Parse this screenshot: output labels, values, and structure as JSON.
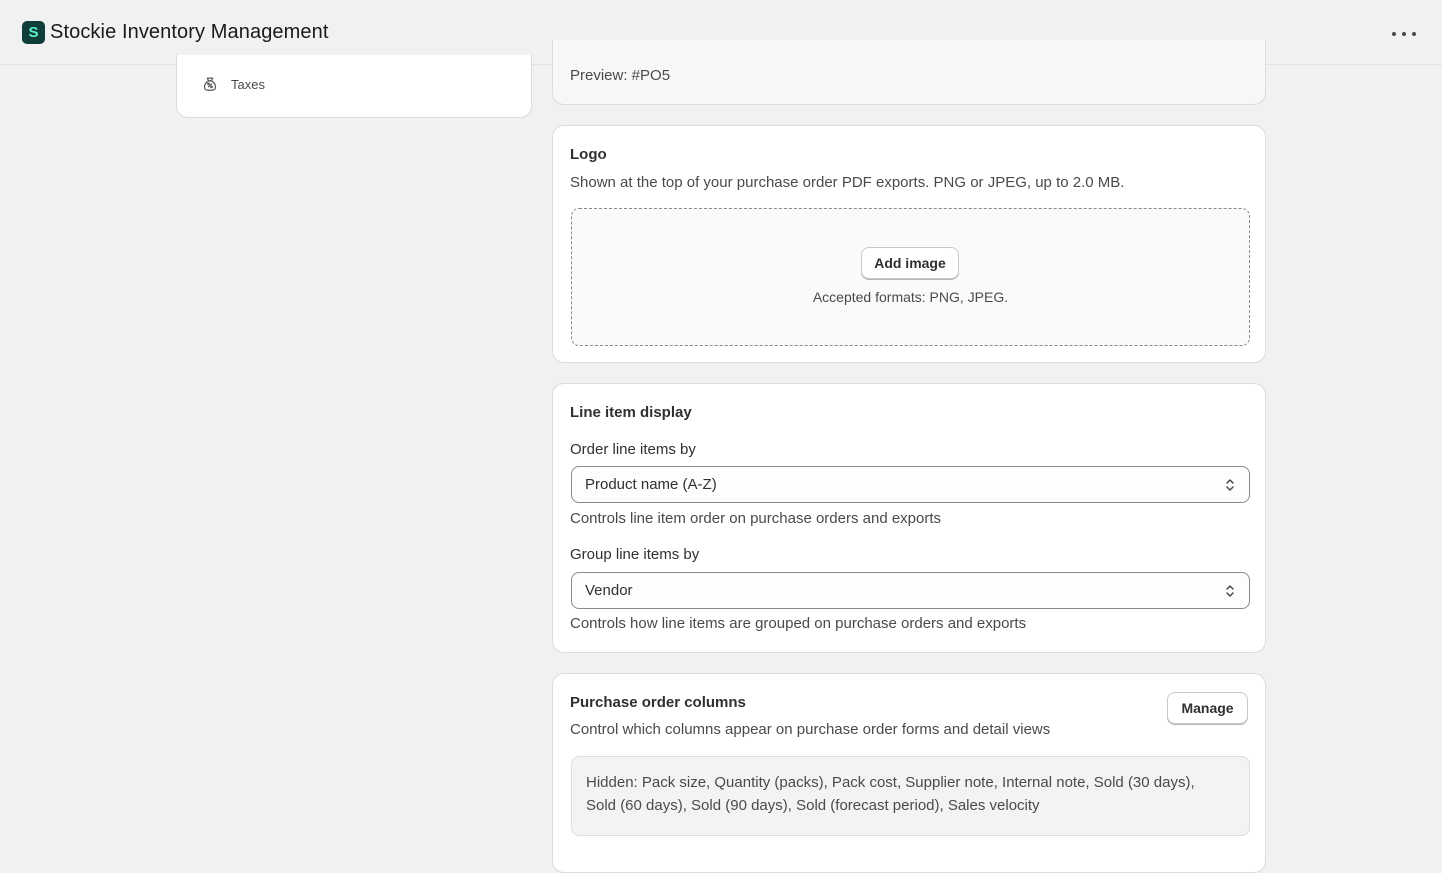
{
  "app": {
    "title": "Stockie Inventory Management",
    "logo_letter": "S"
  },
  "sidebar": {
    "items": [
      {
        "label": "Taxes",
        "icon": "tax-bag-icon"
      }
    ]
  },
  "numbering": {
    "preview": "Preview: #PO5"
  },
  "logo_card": {
    "heading": "Logo",
    "description": "Shown at the top of your purchase order PDF exports. PNG or JPEG, up to 2.0 MB.",
    "add_button": "Add image",
    "accepted": "Accepted formats: PNG, JPEG."
  },
  "line_items": {
    "heading": "Line item display",
    "order_label": "Order line items by",
    "order_value": "Product name (A-Z)",
    "order_help": "Controls line item order on purchase orders and exports",
    "group_label": "Group line items by",
    "group_value": "Vendor",
    "group_help": "Controls how line items are grouped on purchase orders and exports"
  },
  "columns": {
    "heading": "Purchase order columns",
    "description": "Control which columns appear on purchase order forms and detail views",
    "manage_button": "Manage",
    "hidden_line1": "Hidden: Pack size, Quantity (packs), Pack cost, Supplier note, Internal note, Sold (30 days),",
    "hidden_line2": "Sold (60 days), Sold (90 days), Sold (forecast period), Sales velocity"
  },
  "colors": {
    "logo_bg": "#0f3d3a",
    "logo_fg": "#5ef2c6",
    "page_bg": "#f1f1f1"
  }
}
